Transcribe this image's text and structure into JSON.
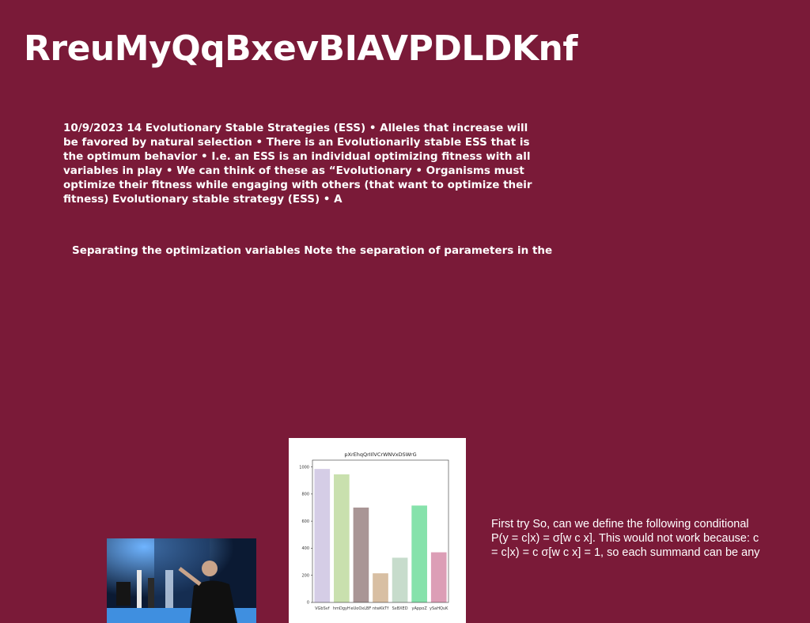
{
  "slide": {
    "title": "RreuMyQqBxevBIAVPDLDKnf",
    "paragraph1": "10/9/2023 14 Evolutionary Stable Strategies (ESS) • Alleles that increase will be favored by natural selection • There is an Evolutionarily stable ESS that is the optimum behavior • I.e. an ESS is an individual optimizing fitness with all variables in play • We can think of these as “Evolutionary • Organisms must optimize their fitness while engaging with others (that want to optimize their fitness) Evolutionary stable strategy (ESS) • A",
    "paragraph2": "Separating the optimization variables Note the separation of parameters in the",
    "paragraph3_line1": "First try So, can we define the following conditional",
    "paragraph3_line2": "P(y = c|x) = σ[w  c x]. This would not work because:  c",
    "paragraph3_line3": "= c|x) =  c σ[w  c x] = 1, so each summand can be any",
    "background_color": "#7a1a38"
  },
  "photo": {
    "description_icon": "person-pouring-drink-photo"
  },
  "chart_data": {
    "type": "bar",
    "title": "pXrEhqQrIIlVCrWNVxDSWrG",
    "categories": [
      "VGbSvf",
      "hmDgyH",
      "eUoOxLBF",
      "ntwKkTf",
      "SxBXED",
      "yAppoZ",
      "ySaHQuK"
    ],
    "values": [
      985,
      945,
      700,
      215,
      330,
      715,
      370
    ],
    "colors": [
      "#d5cde6",
      "#c9e0ae",
      "#a99595",
      "#d8bfa3",
      "#c7dccc",
      "#86e2ab",
      "#dc9eb6"
    ],
    "ylim": [
      0,
      1050
    ],
    "yticks": [
      0,
      200,
      400,
      600,
      800,
      1000
    ],
    "xlabel": "",
    "ylabel": ""
  }
}
